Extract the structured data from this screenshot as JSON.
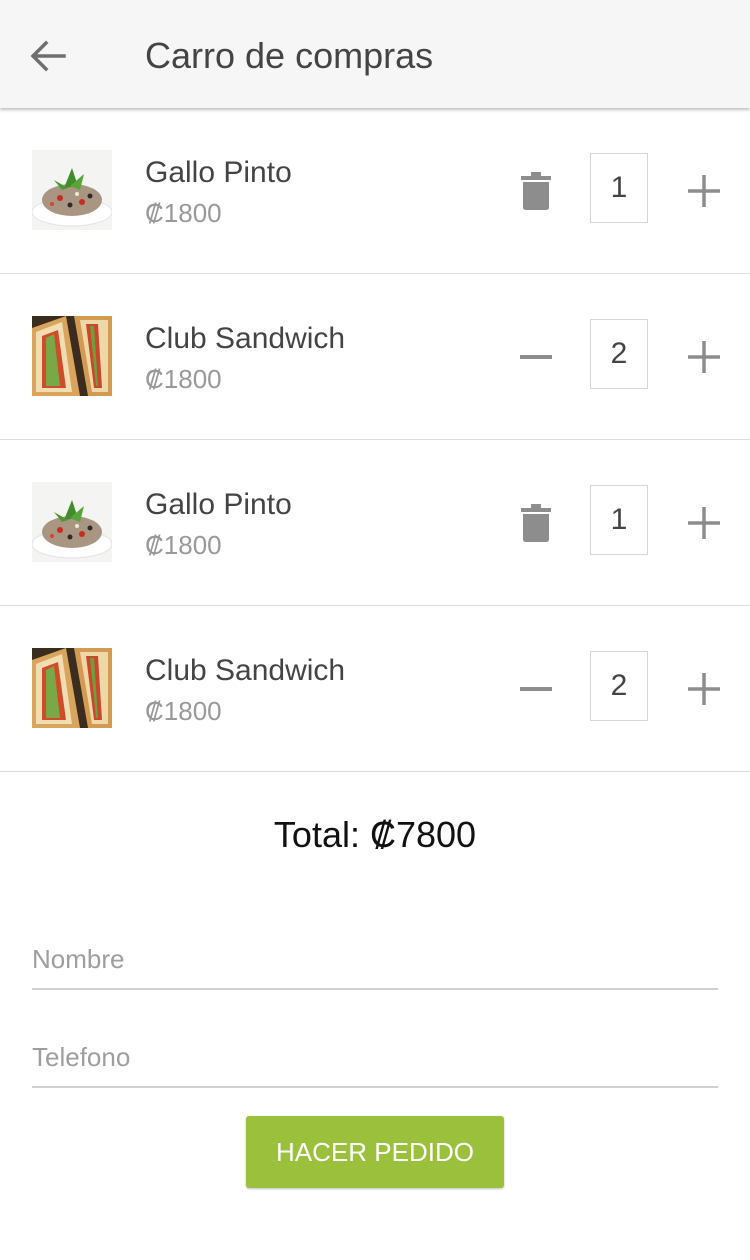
{
  "appbar": {
    "title": "Carro de compras",
    "back_icon": "arrow-left-icon"
  },
  "cart": {
    "items": [
      {
        "name": "Gallo Pinto",
        "price": "₡1800",
        "quantity": "1",
        "action_icon": "trash-icon",
        "image": "gallo-pinto"
      },
      {
        "name": "Club Sandwich",
        "price": "₡1800",
        "quantity": "2",
        "action_icon": "minus-icon",
        "image": "club-sandwich"
      },
      {
        "name": "Gallo Pinto",
        "price": "₡1800",
        "quantity": "1",
        "action_icon": "trash-icon",
        "image": "gallo-pinto"
      },
      {
        "name": "Club Sandwich",
        "price": "₡1800",
        "quantity": "2",
        "action_icon": "minus-icon",
        "image": "club-sandwich"
      }
    ]
  },
  "total": "Total: ₡7800",
  "form": {
    "name_placeholder": "Nombre",
    "phone_placeholder": "Telefono"
  },
  "order_button": "HACER PEDIDO",
  "colors": {
    "accent": "#9bc13c",
    "appbar": "#f6f6f6"
  }
}
